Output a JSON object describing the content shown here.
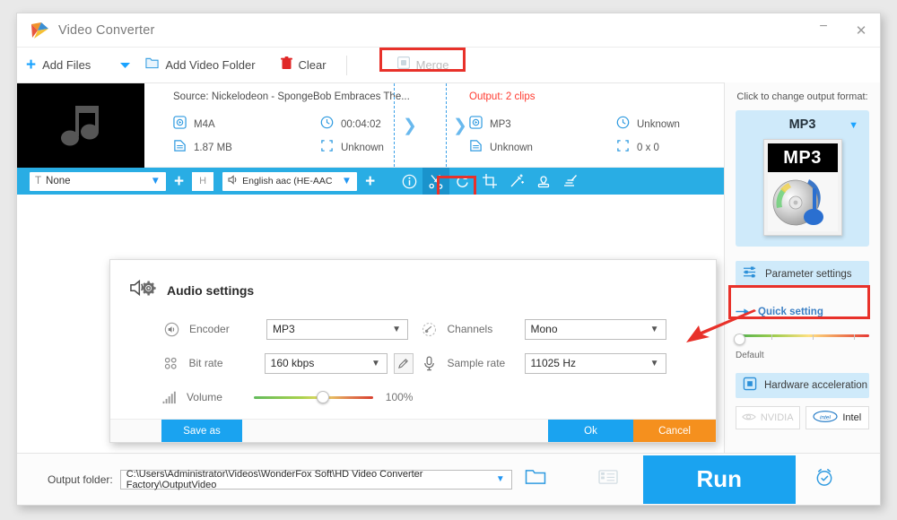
{
  "window": {
    "title": "Video Converter",
    "minimize_label": "−",
    "close_label": "✕"
  },
  "toolbar": {
    "add_files_label": "Add Files",
    "add_video_folder_label": "Add Video Folder",
    "clear_label": "Clear",
    "merge_label": "Merge"
  },
  "file_row": {
    "source_title": "Source: Nickelodeon - SpongeBob Embraces The...",
    "output_title": "Output: 2 clips",
    "source": {
      "format": "M4A",
      "duration": "00:04:02",
      "size": "1.87 MB",
      "resolution": "Unknown"
    },
    "output": {
      "format": "MP3",
      "duration": "Unknown",
      "size": "Unknown",
      "resolution": "0 x 0"
    },
    "close_label": "✕"
  },
  "track_bar": {
    "subtitle_track": "None",
    "audio_track": "English aac (HE-AAC",
    "h_button_label": "H",
    "add_subtitle_label": "+",
    "add_audio_label": "+",
    "tools": [
      {
        "name": "info-icon",
        "active": false
      },
      {
        "name": "trim-scissors-icon",
        "active": true
      },
      {
        "name": "rotate-icon",
        "active": false
      },
      {
        "name": "crop-icon",
        "active": false
      },
      {
        "name": "effects-wand-icon",
        "active": false
      },
      {
        "name": "watermark-stamp-icon",
        "active": false
      },
      {
        "name": "subtitle-edit-icon",
        "active": false
      }
    ]
  },
  "annotations": {
    "trim_label": "Trim",
    "accent_color": "#e8312a"
  },
  "dialog": {
    "title": "Audio settings",
    "fields": {
      "encoder_label": "Encoder",
      "encoder_value": "MP3",
      "bitrate_label": "Bit rate",
      "bitrate_value": "160 kbps",
      "volume_label": "Volume",
      "volume_value": "100%",
      "channels_label": "Channels",
      "channels_value": "Mono",
      "samplerate_label": "Sample rate",
      "samplerate_value": "11025 Hz"
    },
    "buttons": {
      "save_as": "Save as",
      "ok": "Ok",
      "cancel": "Cancel"
    }
  },
  "right_panel": {
    "hint": "Click to change output format:",
    "format_name": "MP3",
    "format_icon_text": "MP3",
    "parameter_settings_label": "Parameter settings",
    "quick_setting_label": "Quick setting",
    "quick_slider_caption": "Default",
    "hardware_acceleration_label": "Hardware acceleration",
    "gpu_nvidia_label": "NVIDIA",
    "gpu_intel_label": "Intel"
  },
  "bottom_bar": {
    "output_folder_label": "Output folder:",
    "output_folder_path": "C:\\Users\\Administrator\\Videos\\WonderFox Soft\\HD Video Converter Factory\\OutputVideo",
    "run_label": "Run"
  }
}
